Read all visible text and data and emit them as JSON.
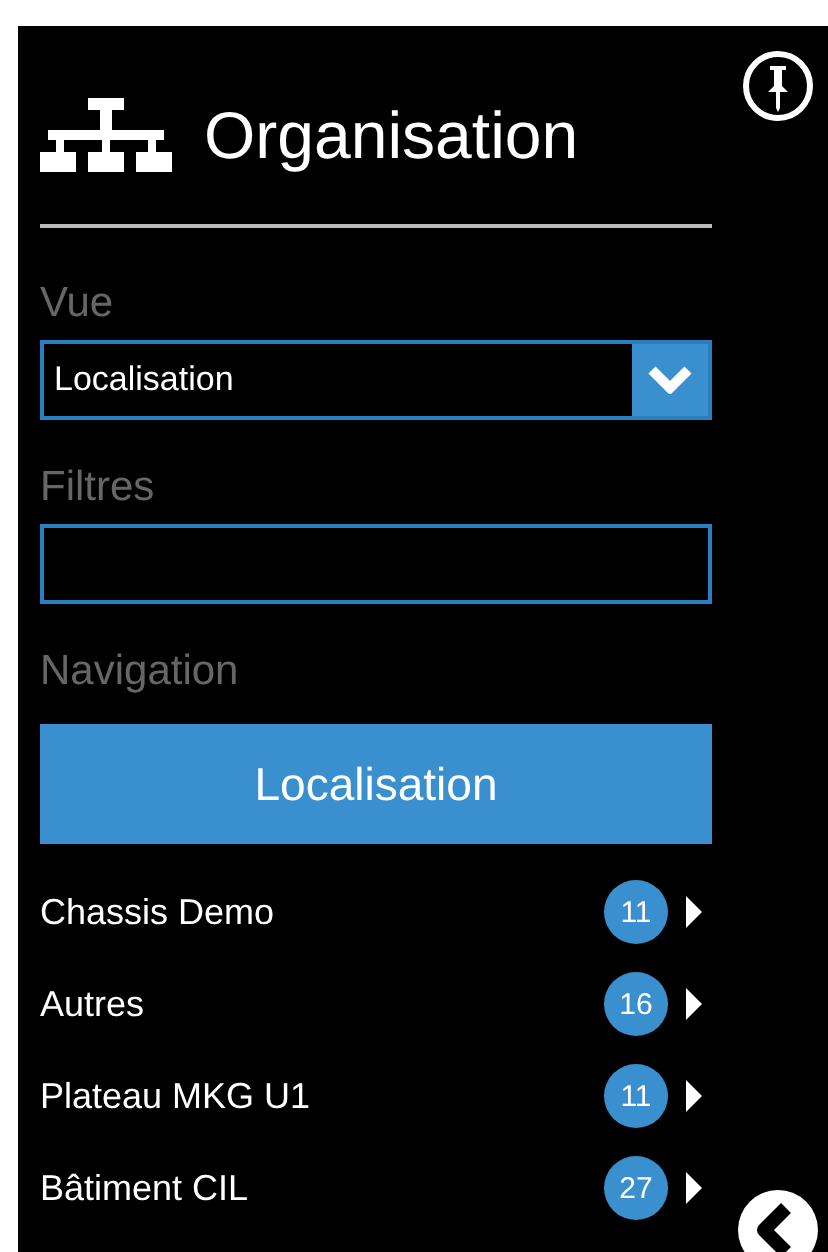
{
  "header": {
    "title": "Organisation"
  },
  "view": {
    "label": "Vue",
    "value": "Localisation"
  },
  "filters": {
    "label": "Filtres"
  },
  "navigation": {
    "label": "Navigation",
    "button": "Localisation",
    "items": [
      {
        "name": "Chassis Demo",
        "count": "11"
      },
      {
        "name": "Autres",
        "count": "16"
      },
      {
        "name": "Plateau MKG U1",
        "count": "11"
      },
      {
        "name": "Bâtiment CIL",
        "count": "27"
      }
    ]
  }
}
